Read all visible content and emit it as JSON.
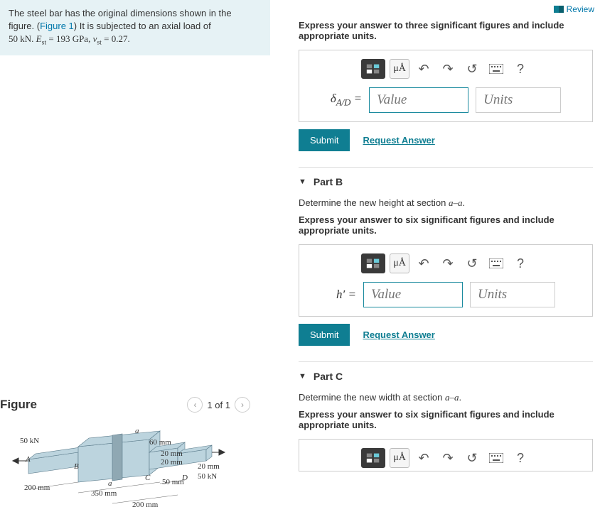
{
  "review": "Review",
  "problem": {
    "line1": "The steel bar has the original dimensions shown in the",
    "line2a": "figure. (",
    "figlink": "Figure 1",
    "line2b": ") It is subjected to an axial load of",
    "load": "50 kN",
    "E_label": "E",
    "E_sub": "st",
    "E_val": " = 193 GPa",
    "nu_label": "ν",
    "nu_sub": "st",
    "nu_val": " = 0.27"
  },
  "figure": {
    "title": "Figure",
    "pager": "1 of 1",
    "labels": {
      "force_left": "50 kN",
      "force_right": "50 kN",
      "A": "A",
      "B": "B",
      "C": "C",
      "D": "D",
      "a_top": "a",
      "a_bot": "a",
      "h60": "60 mm",
      "w20a": "20 mm",
      "w20b": "20 mm",
      "d20": "20 mm",
      "l200a": "200 mm",
      "l200b": "200 mm",
      "l350": "350 mm",
      "l50": "50 mm"
    }
  },
  "partA": {
    "instruction": "Express your answer to three significant figures and include appropriate units.",
    "var": "δ",
    "var_sub": "A/D",
    "value_ph": "Value",
    "units_ph": "Units",
    "submit": "Submit",
    "request": "Request Answer",
    "mu": "μÅ"
  },
  "partB": {
    "title": "Part B",
    "prompt_a": "Determine the new height at section ",
    "prompt_sec": "a–a",
    "instruction": "Express your answer to six significant figures and include appropriate units.",
    "var": "h′",
    "value_ph": "Value",
    "units_ph": "Units",
    "submit": "Submit",
    "request": "Request Answer",
    "mu": "μÅ"
  },
  "partC": {
    "title": "Part C",
    "prompt_a": "Determine the new width at section ",
    "prompt_sec": "a–a",
    "instruction": "Express your answer to six significant figures and include appropriate units.",
    "mu": "μÅ"
  }
}
